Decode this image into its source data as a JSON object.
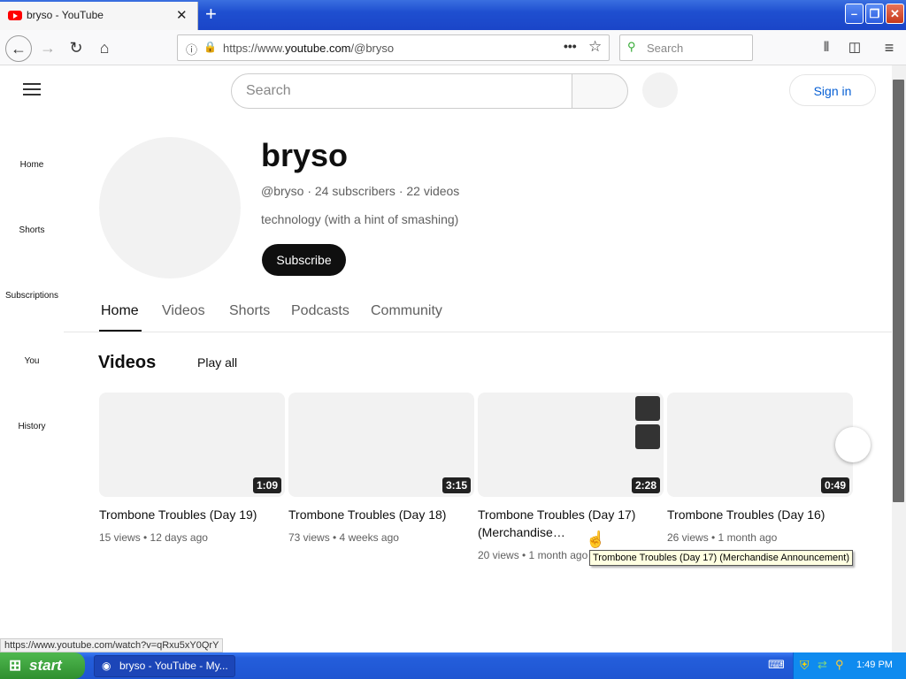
{
  "browser": {
    "tab_title": "bryso - YouTube",
    "url_prefix": "https://www.",
    "url_domain": "youtube.com",
    "url_path": "/@bryso",
    "search_placeholder": "Search"
  },
  "youtube": {
    "search_placeholder": "Search",
    "signin_label": "Sign in",
    "sidebar": [
      "Home",
      "Shorts",
      "Subscriptions",
      "You",
      "History"
    ],
    "channel": {
      "name": "bryso",
      "meta": "@bryso · 24 subscribers · 22 videos",
      "description": "technology (with a hint of smashing)",
      "subscribe_label": "Subscribe"
    },
    "tabs": [
      "Home",
      "Videos",
      "Shorts",
      "Podcasts",
      "Community"
    ],
    "section_title": "Videos",
    "play_all": "Play all",
    "videos": [
      {
        "title": "Trombone Troubles (Day 19)",
        "duration": "1:09",
        "meta": "15 views • 12 days ago"
      },
      {
        "title": "Trombone Troubles (Day 18)",
        "duration": "3:15",
        "meta": "73 views • 4 weeks ago"
      },
      {
        "title": "Trombone Troubles (Day 17) (Merchandise…",
        "duration": "2:28",
        "meta": "20 views • 1 month ago"
      },
      {
        "title": "Trombone Troubles (Day 16)",
        "duration": "0:49",
        "meta": "26 views • 1 month ago"
      }
    ],
    "tooltip": "Trombone Troubles (Day 17) (Merchandise Announcement)",
    "status_url": "https://www.youtube.com/watch?v=qRxu5xY0QrY"
  },
  "taskbar": {
    "start_label": "start",
    "task_label": "bryso - YouTube - My...",
    "clock": "1:49 PM"
  }
}
